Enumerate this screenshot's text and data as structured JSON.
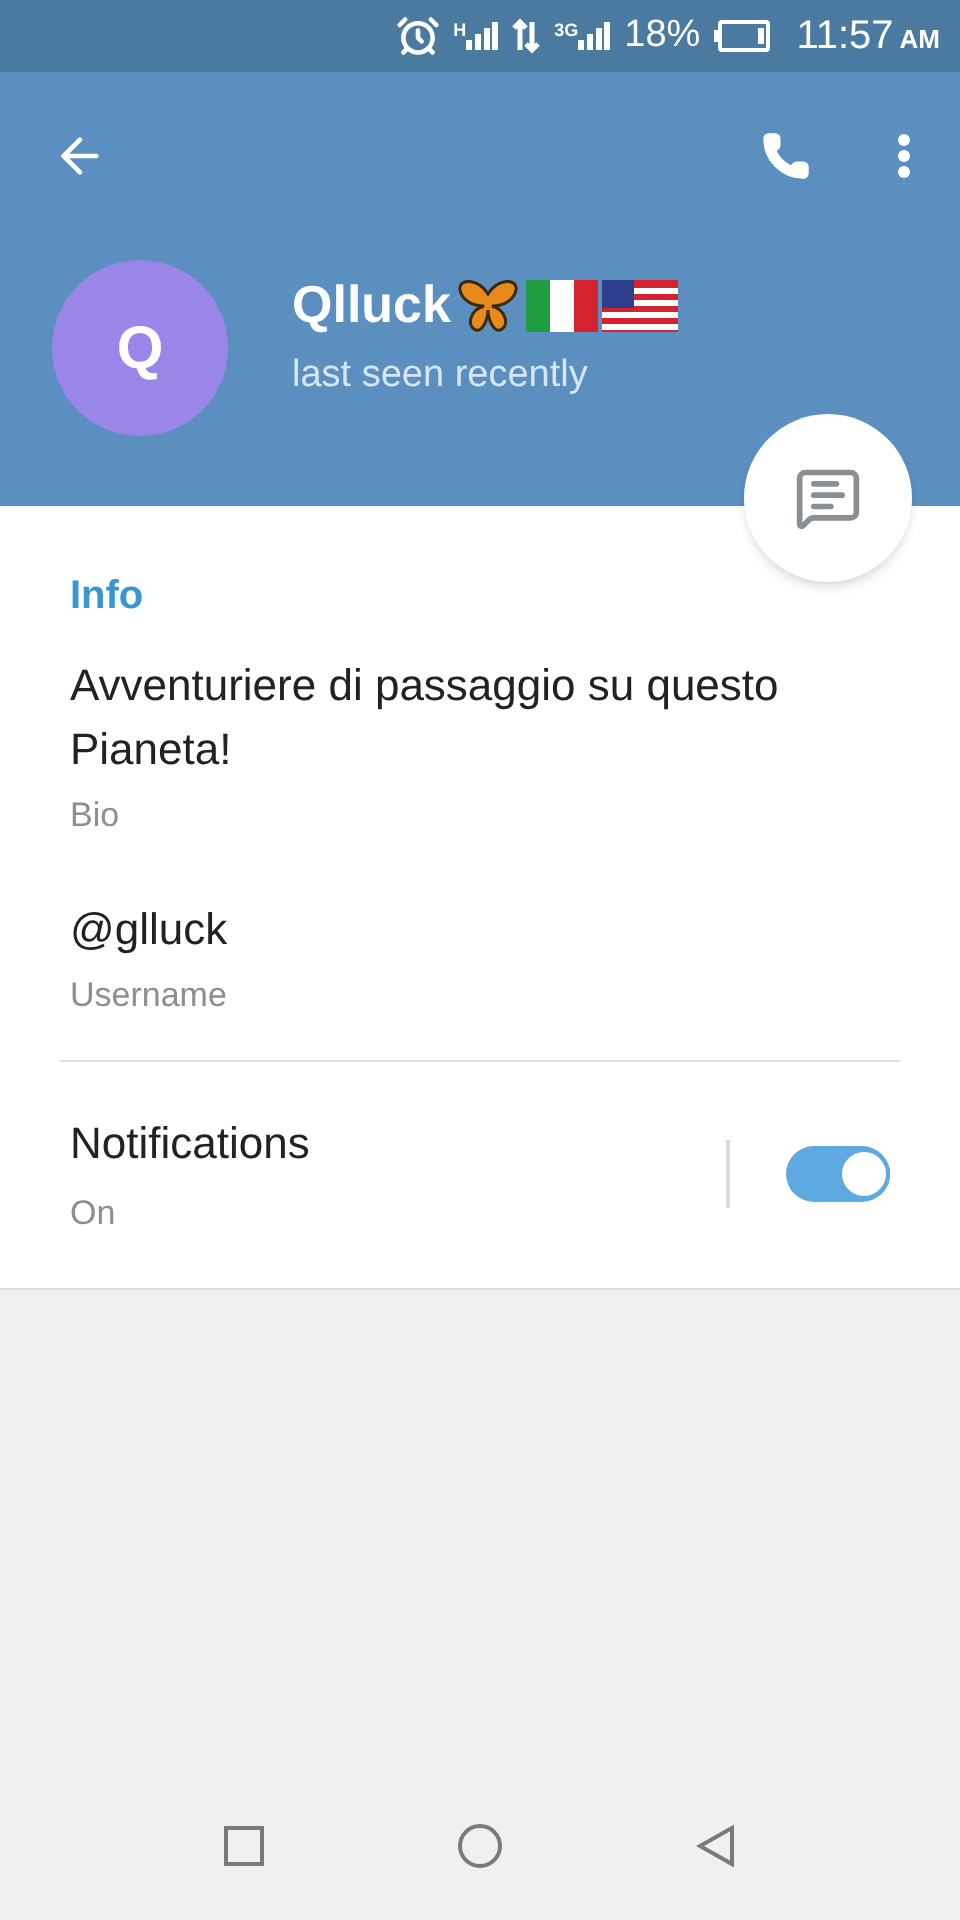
{
  "status_bar": {
    "network_1": "H",
    "network_2": "3G",
    "battery": "18%",
    "time": "11:57",
    "ampm": "AM"
  },
  "header": {
    "avatar_letter": "Q",
    "name": "Qlluck",
    "status": "last seen recently"
  },
  "info": {
    "title": "Info",
    "items": [
      {
        "value": "Avventuriere di passaggio su questo Pianeta!",
        "label": "Bio"
      },
      {
        "value": "@glluck",
        "label": "Username"
      }
    ],
    "notifications": {
      "title": "Notifications",
      "value": "On",
      "on": true
    }
  }
}
